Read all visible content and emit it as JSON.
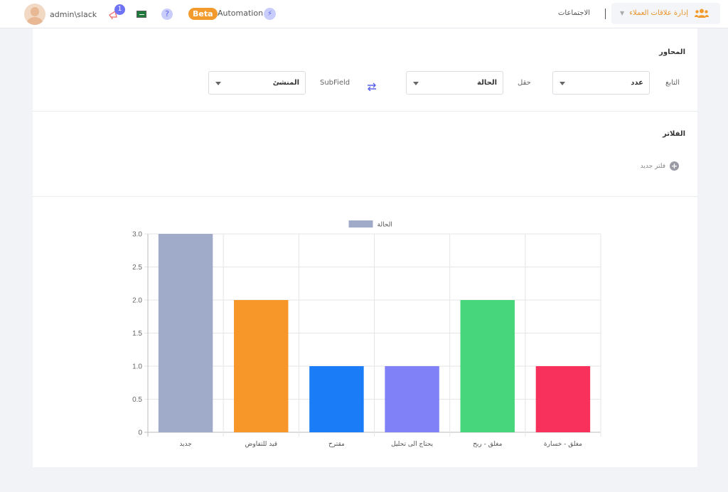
{
  "topbar": {
    "username": "admin\\slack",
    "notification_count": "1",
    "help_glyph": "?",
    "beta_label": "Beta",
    "automation_label": "Automation",
    "meetings_label": "الاجتماعات",
    "module_label": "إدارة علاقات العملاء",
    "icons": [
      "avatar",
      "megaphone-icon",
      "saudi-flag-icon",
      "help-icon",
      "bolt-icon",
      "chevron-down-icon",
      "users-icon"
    ]
  },
  "axes": {
    "title": "المحاور",
    "function_label": "التابع",
    "function_value": "عدد",
    "field_label": "حقل",
    "field_value": "الحالة",
    "subfield_label": "SubField",
    "subfield_value": "المنشئ"
  },
  "filters": {
    "title": "الفلاتر",
    "add_filter_label": "فلتر جديد"
  },
  "chart_data": {
    "type": "bar",
    "categories": [
      "جديد",
      "قيد للتفاوض",
      "مقترح",
      "يحتاج الى تحليل",
      "مغلق - ربح",
      "مغلق - خسارة"
    ],
    "series": [
      {
        "name": "الحالة",
        "values": [
          3,
          2,
          1,
          1,
          2,
          1
        ]
      }
    ],
    "colors": [
      "#a0aac9",
      "#f7972a",
      "#1a7cf7",
      "#8080f7",
      "#47d67b",
      "#f7305c"
    ],
    "legend_color": "#a0aac9",
    "yticks": [
      "0",
      "0.5",
      "1.0",
      "1.5",
      "2.0",
      "2.5",
      "3.0"
    ],
    "ylim": [
      0,
      3
    ],
    "grid": true,
    "legend": "top-center"
  }
}
